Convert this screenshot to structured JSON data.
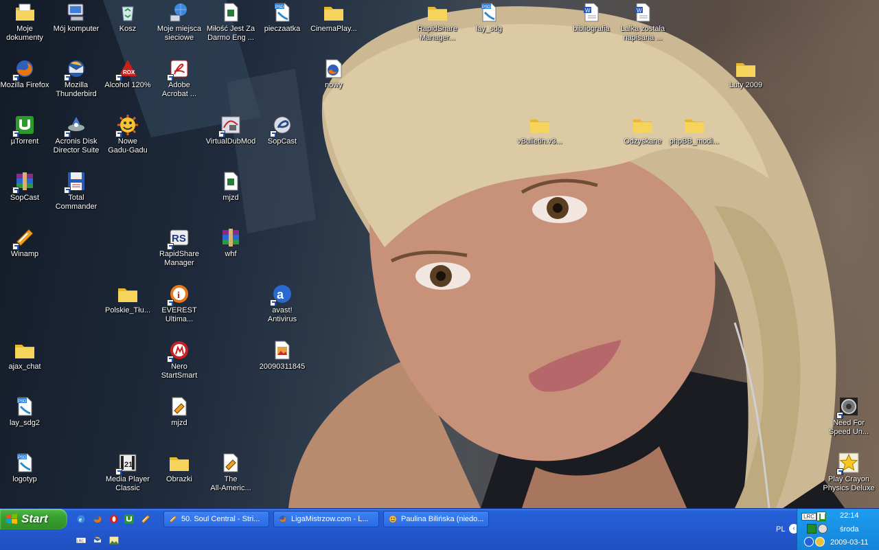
{
  "desktop": {
    "icons": [
      {
        "id": "moje-dokumenty",
        "label": "Moje\ndokumenty",
        "icon": "documents-folder-icon"
      },
      {
        "id": "moj-komputer",
        "label": "Mój komputer",
        "icon": "computer-icon"
      },
      {
        "id": "kosz",
        "label": "Kosz",
        "icon": "recycle-bin-icon"
      },
      {
        "id": "moje-miejsca",
        "label": "Moje miejsca\nsieciowe",
        "icon": "network-places-icon"
      },
      {
        "id": "milosc",
        "label": "Miłość Jest Za\nDarmo Eng ...",
        "icon": "document-icon"
      },
      {
        "id": "pieczaatka",
        "label": "pieczaatka",
        "icon": "psd-file-icon"
      },
      {
        "id": "cinemaplay",
        "label": "CinemaPlay...",
        "icon": "folder-icon"
      },
      {
        "id": "rapidshare-manager-folder",
        "label": "RapidShare\nManager...",
        "icon": "folder-icon"
      },
      {
        "id": "lay-sdg",
        "label": "lay_sdg",
        "icon": "psd-file-icon"
      },
      {
        "id": "bibliografia",
        "label": "bibliografia",
        "icon": "word-document-icon"
      },
      {
        "id": "lalka",
        "label": "Lalka została\nnapisana ...",
        "icon": "word-document-icon"
      },
      {
        "id": "firefox",
        "label": "Mozilla Firefox",
        "icon": "firefox-icon"
      },
      {
        "id": "thunderbird",
        "label": "Mozilla\nThunderbird",
        "icon": "thunderbird-icon"
      },
      {
        "id": "alcohol",
        "label": "Alcohol 120%",
        "icon": "alcohol-icon"
      },
      {
        "id": "acrobat",
        "label": "Adobe\nAcrobat ...",
        "icon": "acrobat-icon"
      },
      {
        "id": "nowy",
        "label": "nowy",
        "icon": "firefox-file-icon"
      },
      {
        "id": "luty-2009",
        "label": "Luty 2009",
        "icon": "folder-icon"
      },
      {
        "id": "utorrent",
        "label": "µTorrent",
        "icon": "utorrent-icon"
      },
      {
        "id": "acronis",
        "label": "Acronis Disk\nDirector Suite",
        "icon": "acronis-icon"
      },
      {
        "id": "gadu",
        "label": "Nowe\nGadu-Gadu",
        "icon": "gadu-gadu-icon"
      },
      {
        "id": "virtualdubmod",
        "label": "VirtualDubMod",
        "icon": "virtualdub-icon"
      },
      {
        "id": "sopcast-1",
        "label": "SopCast",
        "icon": "sopcast-icon"
      },
      {
        "id": "vbulletin",
        "label": "vBulletin.v3...",
        "icon": "folder-icon"
      },
      {
        "id": "odzyskane",
        "label": "Odzyskane",
        "icon": "folder-icon"
      },
      {
        "id": "phpbb",
        "label": "phpBB_modi...",
        "icon": "folder-icon"
      },
      {
        "id": "sopcast-2",
        "label": "SopCast",
        "icon": "winrar-icon"
      },
      {
        "id": "total-commander",
        "label": "Total\nCommander",
        "icon": "floppy-icon"
      },
      {
        "id": "mjzd-1",
        "label": "mjzd",
        "icon": "document-icon"
      },
      {
        "id": "winamp",
        "label": "Winamp",
        "icon": "winamp-icon"
      },
      {
        "id": "rapidshare-manager",
        "label": "RapidShare\nManager",
        "icon": "rapidshare-icon"
      },
      {
        "id": "whf",
        "label": "whf",
        "icon": "winrar-icon"
      },
      {
        "id": "polskie",
        "label": "Polskie_Tłu...",
        "icon": "folder-icon"
      },
      {
        "id": "everest",
        "label": "EVEREST\nUltima...",
        "icon": "everest-icon"
      },
      {
        "id": "avast",
        "label": "avast!\nAntivirus",
        "icon": "avast-icon"
      },
      {
        "id": "ajax-chat",
        "label": "ajax_chat",
        "icon": "folder-icon"
      },
      {
        "id": "nero",
        "label": "Nero\nStartSmart",
        "icon": "nero-icon"
      },
      {
        "id": "file-20090311845",
        "label": "20090311845",
        "icon": "image-file-icon"
      },
      {
        "id": "lay-sdg2",
        "label": "lay_sdg2",
        "icon": "psd-file-icon"
      },
      {
        "id": "mjzd-2",
        "label": "mjzd",
        "icon": "winamp-file-icon"
      },
      {
        "id": "need-for-speed",
        "label": "Need For\nSpeed Un...",
        "icon": "need-for-speed-icon"
      },
      {
        "id": "logotyp",
        "label": "logotyp",
        "icon": "psd-file-icon"
      },
      {
        "id": "mpc",
        "label": "Media Player\nClassic",
        "icon": "media-player-classic-icon"
      },
      {
        "id": "obrazki",
        "label": "Obrazki",
        "icon": "folder-icon"
      },
      {
        "id": "the-all-american",
        "label": "The\nAll-Americ...",
        "icon": "winamp-file-icon"
      },
      {
        "id": "crayon-physics",
        "label": "Play Crayon\nPhysics Deluxe",
        "icon": "crayon-star-icon"
      }
    ]
  },
  "taskbar": {
    "start_label": "Start",
    "quick_launch": [
      {
        "id": "ie",
        "icon": "internet-explorer-icon"
      },
      {
        "id": "firefox",
        "icon": "firefox-icon"
      },
      {
        "id": "opera",
        "icon": "opera-icon"
      },
      {
        "id": "utorrent",
        "icon": "utorrent-icon"
      },
      {
        "id": "winamp",
        "icon": "winamp-icon"
      },
      {
        "id": "lrc",
        "icon": "lrc-icon"
      },
      {
        "id": "thunderbird",
        "icon": "thunderbird-icon"
      },
      {
        "id": "image",
        "icon": "image-icon"
      }
    ],
    "tasks": [
      {
        "id": "soul-central",
        "label": "50. Soul Central - Stri...",
        "icon": "winamp-icon"
      },
      {
        "id": "ligamistrzow",
        "label": "LigaMistrzow.com - L...",
        "icon": "firefox-icon"
      },
      {
        "id": "paulina",
        "label": "Paulina Bilińska (niedo...",
        "icon": "gadu-gadu-icon"
      }
    ],
    "language": "PL",
    "language_arrow": "‹",
    "clock": {
      "time": "22:14",
      "day": "środa",
      "date": "2009-03-11"
    },
    "tray_labels": {
      "lrc": "LRC"
    }
  },
  "colors": {
    "taskbar_blue": "#2458d0",
    "start_green": "#37a12f",
    "tray_blue": "#1584d8",
    "folder_yellow": "#f4cf4a"
  }
}
